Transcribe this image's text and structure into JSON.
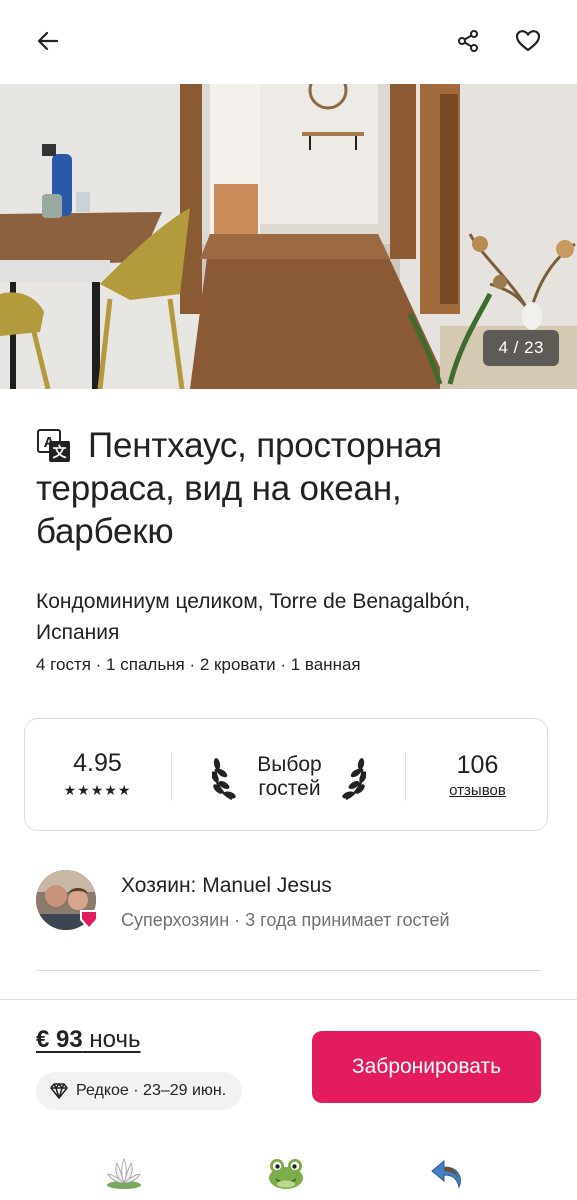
{
  "header": {
    "back_icon": "arrow-left-icon",
    "share_icon": "share-icon",
    "favorite_icon": "heart-icon"
  },
  "gallery": {
    "counter": "4 / 23"
  },
  "listing": {
    "title": "Пентхаус, просторная терраса, вид на океан, барбекю",
    "translate_icon": "translate-icon",
    "subtitle": "Кондоминиум целиком, Torre de Benagalbón, Испания",
    "details": "4 гостя · 1 спальня · 2 кровати · 1 ванная"
  },
  "stats": {
    "rating": "4.95",
    "stars": "★★★★★",
    "guest_choice_line1": "Выбор",
    "guest_choice_line2": "гостей",
    "reviews_count": "106",
    "reviews_label": "отзывов"
  },
  "host": {
    "name": "Хозяин: Manuel Jesus",
    "subtitle": "Суперхозяин · 3 года принимает гостей"
  },
  "booking": {
    "price": "€ 93",
    "price_unit": "ночь",
    "rare_label": "Редкое · 23–29 июн.",
    "book_button": "Забронировать",
    "accent_color": "#e31c5f"
  },
  "navbar": {
    "icons": [
      "lotus-icon",
      "frog-icon",
      "undo-arrow-icon"
    ]
  }
}
